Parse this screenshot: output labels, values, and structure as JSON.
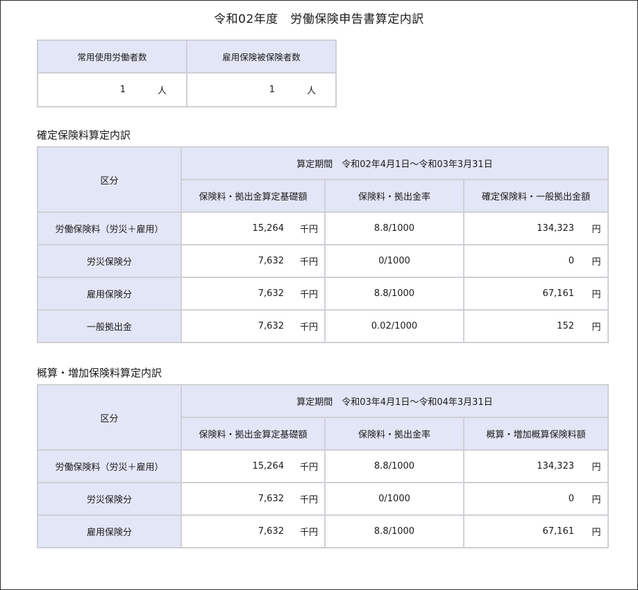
{
  "title": "令和02年度　労働保険申告書算定内訳",
  "workers": {
    "headers": [
      "常用使用労働者数",
      "雇用保険被保険者数"
    ],
    "values": [
      {
        "count": "1",
        "unit": "人"
      },
      {
        "count": "1",
        "unit": "人"
      }
    ]
  },
  "kakutei": {
    "heading": "確定保険料算定内訳",
    "col_category": "区分",
    "period": "算定期間　令和02年4月1日～令和03年3月31日",
    "col_base": "保険料・拠出金算定基礎額",
    "col_rate": "保険料・拠出金率",
    "col_amount": "確定保険料・一般拠出金額",
    "rows": [
      {
        "category": "労働保険料（労災＋雇用）",
        "base": "15,264",
        "base_unit": "千円",
        "rate": "8.8/1000",
        "amount": "134,323",
        "amount_unit": "円"
      },
      {
        "category": "労災保険分",
        "base": "7,632",
        "base_unit": "千円",
        "rate": "0/1000",
        "amount": "0",
        "amount_unit": "円"
      },
      {
        "category": "雇用保険分",
        "base": "7,632",
        "base_unit": "千円",
        "rate": "8.8/1000",
        "amount": "67,161",
        "amount_unit": "円"
      },
      {
        "category": "一般拠出金",
        "base": "7,632",
        "base_unit": "千円",
        "rate": "0.02/1000",
        "amount": "152",
        "amount_unit": "円"
      }
    ]
  },
  "gaisan": {
    "heading": "概算・増加保険料算定内訳",
    "col_category": "区分",
    "period": "算定期間　令和03年4月1日～令和04年3月31日",
    "col_base": "保険料・拠出金算定基礎額",
    "col_rate": "保険料・拠出金率",
    "col_amount": "概算・増加概算保険料額",
    "rows": [
      {
        "category": "労働保険料（労災＋雇用）",
        "base": "15,264",
        "base_unit": "千円",
        "rate": "8.8/1000",
        "amount": "134,323",
        "amount_unit": "円"
      },
      {
        "category": "労災保険分",
        "base": "7,632",
        "base_unit": "千円",
        "rate": "0/1000",
        "amount": "0",
        "amount_unit": "円"
      },
      {
        "category": "雇用保険分",
        "base": "7,632",
        "base_unit": "千円",
        "rate": "8.8/1000",
        "amount": "67,161",
        "amount_unit": "円"
      }
    ]
  }
}
